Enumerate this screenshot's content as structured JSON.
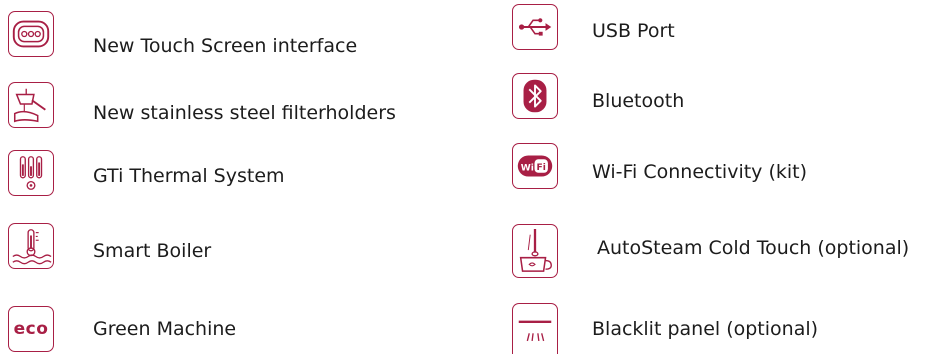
{
  "accent_color": "#a81f45",
  "features_left": [
    {
      "icon": "touch-screen-icon",
      "label": "New Touch Screen interface"
    },
    {
      "icon": "filterholder-icon",
      "label": "New stainless steel filterholders"
    },
    {
      "icon": "thermal-system-icon",
      "label": "GTi Thermal System"
    },
    {
      "icon": "smart-boiler-icon",
      "label": "Smart Boiler"
    },
    {
      "icon": "eco-icon",
      "icon_text": "eco",
      "label": "Green Machine"
    }
  ],
  "features_right": [
    {
      "icon": "usb-icon",
      "label": "USB Port"
    },
    {
      "icon": "bluetooth-icon",
      "label": "Bluetooth"
    },
    {
      "icon": "wifi-icon",
      "icon_text": "Wi Fi",
      "label": "Wi-Fi Connectivity (kit)"
    },
    {
      "icon": "autosteam-icon",
      "label": "AutoSteam Cold Touch (optional)"
    },
    {
      "icon": "backlit-panel-icon",
      "label": "Blacklit panel  (optional)"
    }
  ]
}
